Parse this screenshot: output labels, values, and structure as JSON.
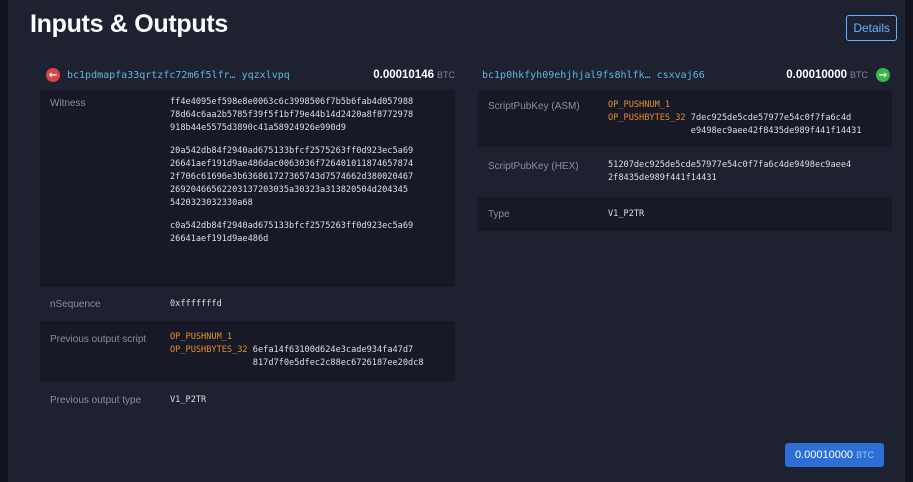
{
  "header": {
    "title": "Inputs & Outputs",
    "details_label": "Details"
  },
  "input": {
    "address": "bc1pdmapfa33qrtzfc72m6f5lfr… yqzxlvpq",
    "amount": "0.00010146",
    "unit": "BTC",
    "witness_label": "Witness",
    "witness": [
      "ff4e4095ef598e8e0063c6c3998506f7b5b6fab4d057988\n78d64c6aa2b5785f39f5f1bf79e44b14d2420a8f8772978\n918b44e5575d3890c41a58924926e990d9",
      "20a542db84f2940ad675133bfcf2575263ff0d923ec5a69\n26641aef191d9ae486dac0063036f726401011874657874\n2f706c61696e3b636861727365743d7574662d380020467\n26920466562203137203035a30323a313820504d204345\n5420323032330a68",
      "c0a542db84f2940ad675133bfcf2575263ff0d923ec5a69\n26641aef191d9ae486d"
    ],
    "nsequence_label": "nSequence",
    "nsequence": "0xfffffffd",
    "prev_script_label": "Previous output script",
    "prev_script_op1": "OP_PUSHNUM_1",
    "prev_script_op2": "OP_PUSHBYTES_32",
    "prev_script_hex": "6efa14f63100d624e3cade934fa47d7\n817d7f0e5dfec2c88ec6726187ee20dc8",
    "prev_type_label": "Previous output type",
    "prev_type": "V1_P2TR"
  },
  "output": {
    "address": "bc1p0hkfyh09ehjhjal9fs8hlfk… csxvaj66",
    "amount": "0.00010000",
    "unit": "BTC",
    "asm_label": "ScriptPubKey (ASM)",
    "asm_op1": "OP_PUSHNUM_1",
    "asm_op2": "OP_PUSHBYTES_32",
    "asm_hex": "7dec925de5cde57977e54c0f7fa6c4d\ne9498ec9aee42f8435de989f441f14431",
    "hex_label": "ScriptPubKey (HEX)",
    "hex": "51207dec925de5cde57977e54c0f7fa6c4de9498ec9aee4\n2f8435de989f441f14431",
    "type_label": "Type",
    "type": "V1_P2TR"
  },
  "total": {
    "amount": "0.00010000",
    "unit": "BTC"
  },
  "colors": {
    "accent": "#66b3ff",
    "address": "#5fb6e0",
    "opcode": "#e58c2e",
    "input_icon": "#d64545",
    "output_icon": "#3bb54a",
    "total_button": "#2e6fd6"
  },
  "icons": {
    "input": "arrow-left-circle-icon",
    "output": "arrow-right-circle-icon"
  }
}
